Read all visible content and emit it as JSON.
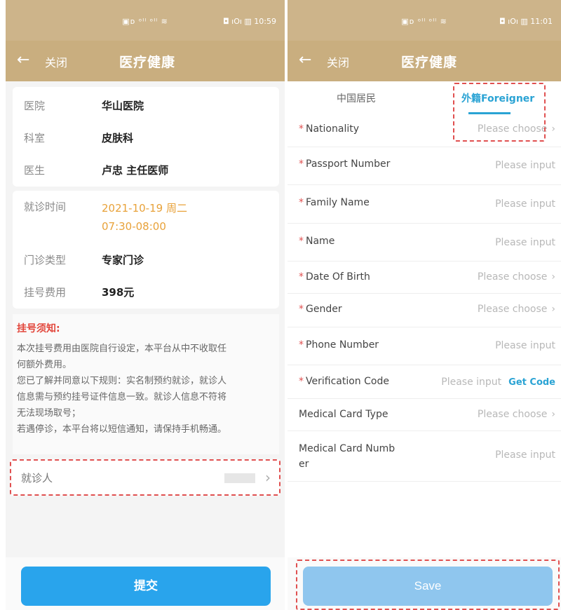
{
  "left": {
    "status_center": "▣ᴅ ᵒᴵˡ ᵒᴵˡ ≋",
    "status_right": "◘ ıOı ▥ 10:59",
    "back_icon": "arrow-left-icon",
    "close_label": "关闭",
    "title": "医疗健康",
    "hospital_label": "医院",
    "hospital_value": "华山医院",
    "dept_label": "科室",
    "dept_value": "皮肤科",
    "doctor_label": "医生",
    "doctor_value": "卢忠 主任医师",
    "time_label": "就诊时间",
    "time_value_1": "2021-10-19 周二",
    "time_value_2": "07:30-08:00",
    "type_label": "门诊类型",
    "type_value": "专家门诊",
    "fee_label": "挂号费用",
    "fee_value": "398元",
    "notice_title": "挂号须知:",
    "notice_lines": [
      "本次挂号费用由医院自行设定，本平台从中不收取任",
      "何额外费用。",
      "您已了解并同意以下规则：实名制预约就诊，就诊人",
      "信息需与预约挂号证件信息一致。就诊人信息不符将",
      "无法现场取号；",
      "若遇停诊，本平台将以短信通知，请保持手机畅通。"
    ],
    "patient_label": "就诊人",
    "submit_label": "提交"
  },
  "right": {
    "status_center": "▣ᴅ ᵒᴵˡ ᵒᴵˡ ≋",
    "status_right": "◘ ıOı ▥ 11:01",
    "back_icon": "arrow-left-icon",
    "close_label": "关闭",
    "title": "医疗健康",
    "tab_resident": "中国居民",
    "tab_foreigner": "外籍Foreigner",
    "fields": [
      {
        "label": "Nationality",
        "required": "*",
        "value": "Please choose",
        "chevron": "›"
      },
      {
        "label": "Passport Number",
        "required": "*",
        "value": "Please input"
      },
      {
        "label": "Family Name",
        "required": "*",
        "value": "Please input"
      },
      {
        "label": "Name",
        "required": "*",
        "value": "Please input"
      },
      {
        "label": "Date Of Birth",
        "required": "*",
        "value": "Please choose",
        "chevron": "›"
      },
      {
        "label": "Gender",
        "required": "*",
        "value": "Please choose",
        "chevron": "›"
      },
      {
        "label": "Phone Number",
        "required": "*",
        "value": "Please input"
      },
      {
        "label": "Verification Code",
        "required": "*",
        "value": "Please input",
        "action": "Get Code"
      },
      {
        "label": "Medical Card Type",
        "value": "Please choose",
        "chevron": "›"
      },
      {
        "label_1": "Medical Card Numb",
        "label_2": "er",
        "value": "Please input"
      }
    ],
    "save_label": "Save"
  },
  "colors": {
    "header": "#c9ae7f",
    "accent_orange": "#e8a23a",
    "submit_blue": "#29a4ec",
    "save_blue": "#8fc6ee",
    "tab_blue": "#2aa3d4",
    "dashed_red": "#e05050"
  }
}
